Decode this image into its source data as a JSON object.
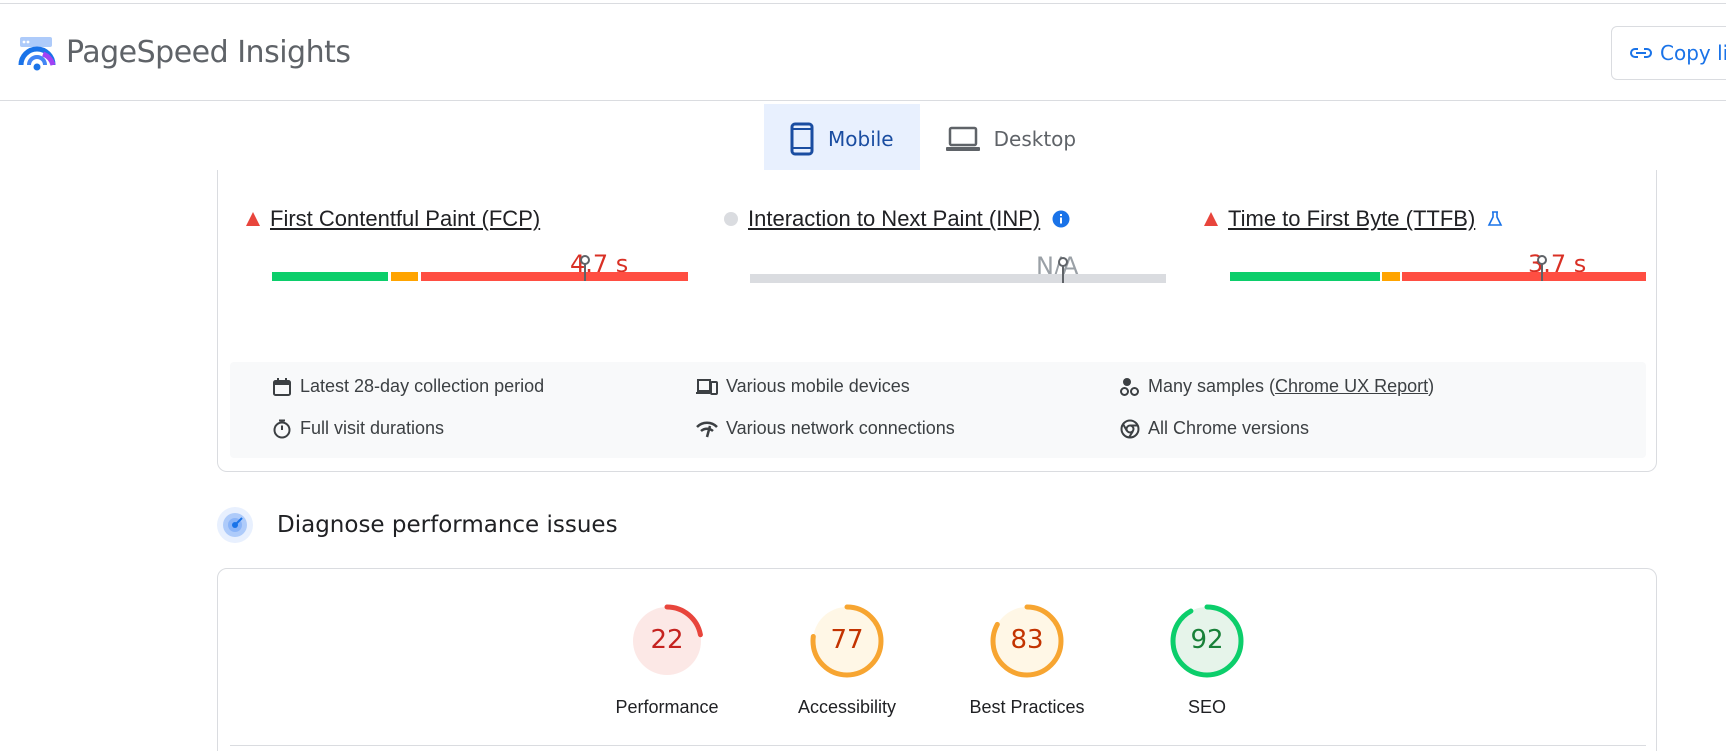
{
  "header": {
    "app_title": "PageSpeed Insights",
    "copy_label": "Copy li"
  },
  "tabs": [
    {
      "label": "Mobile",
      "active": true,
      "icon": "smartphone-icon"
    },
    {
      "label": "Desktop",
      "active": false,
      "icon": "laptop-icon"
    }
  ],
  "metrics": [
    {
      "name": "First Contentful Paint (FCP)",
      "value": "4.7 s",
      "status": "poor",
      "status_color": "#e8453c",
      "extra_icon": null,
      "distribution": [
        0.28,
        0.07,
        0.65
      ],
      "percentile_marker": 0.75
    },
    {
      "name": "Interaction to Next Paint (INP)",
      "value": "N/A",
      "status": "none",
      "status_color": "#dadce0",
      "extra_icon": "info-icon",
      "distribution": [],
      "percentile_marker": 0.75
    },
    {
      "name": "Time to First Byte (TTFB)",
      "value": "3.7 s",
      "status": "poor",
      "status_color": "#e8453c",
      "extra_icon": "flask-icon",
      "distribution": [
        0.36,
        0.04,
        0.6
      ],
      "percentile_marker": 0.75
    }
  ],
  "collection_info": {
    "period": "Latest 28-day collection period",
    "devices": "Various mobile devices",
    "samples_prefix": "Many samples (",
    "samples_link": "Chrome UX Report",
    "samples_suffix": ")",
    "durations": "Full visit durations",
    "network": "Various network connections",
    "chrome_versions": "All Chrome versions"
  },
  "diagnose": {
    "title": "Diagnose performance issues"
  },
  "scores": [
    {
      "label": "Performance",
      "value": 22,
      "color": "#e8453c",
      "text_color": "#c5221f",
      "bg": "#fce8e6"
    },
    {
      "label": "Accessibility",
      "value": 77,
      "color": "#f7a531",
      "text_color": "#c33300",
      "bg": "#fff7e6"
    },
    {
      "label": "Best Practices",
      "value": 83,
      "color": "#f7a531",
      "text_color": "#c33300",
      "bg": "#fff7e6"
    },
    {
      "label": "SEO",
      "value": 92,
      "color": "#0cce6b",
      "text_color": "#188038",
      "bg": "#e6f4ea"
    }
  ],
  "colors": {
    "good": "#0cce6b",
    "needs_improvement": "#ffa400",
    "poor": "#ff4e42",
    "na": "#dadce0",
    "accent": "#1a73e8"
  }
}
